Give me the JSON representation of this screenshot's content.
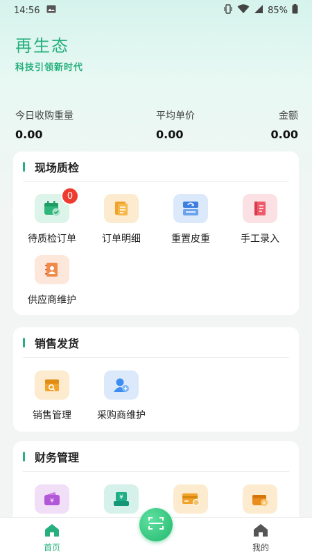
{
  "status_bar": {
    "time": "14:56",
    "battery": "85%"
  },
  "brand": {
    "title": "再生态",
    "subtitle": "科技引领新时代"
  },
  "stats": [
    {
      "label": "今日收购重量",
      "value": "0.00"
    },
    {
      "label": "平均单价",
      "value": "0.00"
    },
    {
      "label": "金额",
      "value": "0.00"
    }
  ],
  "sections": {
    "inspection": {
      "title": "现场质检",
      "items": [
        {
          "label": "待质检订单",
          "icon": "calendar-check-icon",
          "badge": "0"
        },
        {
          "label": "订单明细",
          "icon": "document-list-icon"
        },
        {
          "label": "重置皮重",
          "icon": "reset-tare-icon"
        },
        {
          "label": "手工录入",
          "icon": "notebook-icon"
        },
        {
          "label": "供应商维护",
          "icon": "contact-book-icon"
        }
      ]
    },
    "sales": {
      "title": "销售发货",
      "items": [
        {
          "label": "销售管理",
          "icon": "box-search-icon"
        },
        {
          "label": "采购商维护",
          "icon": "user-add-icon"
        }
      ]
    },
    "finance": {
      "title": "财务管理",
      "items": [
        {
          "label": "",
          "icon": "wallet-yuan-icon"
        },
        {
          "label": "",
          "icon": "cash-register-icon"
        },
        {
          "label": "",
          "icon": "card-gear-icon"
        },
        {
          "label": "",
          "icon": "purse-yuan-icon"
        }
      ]
    }
  },
  "bottom_nav": {
    "home_label": "首页",
    "mine_label": "我的"
  },
  "colors": {
    "accent": "#27b07e",
    "badge": "#ee3b2f"
  }
}
